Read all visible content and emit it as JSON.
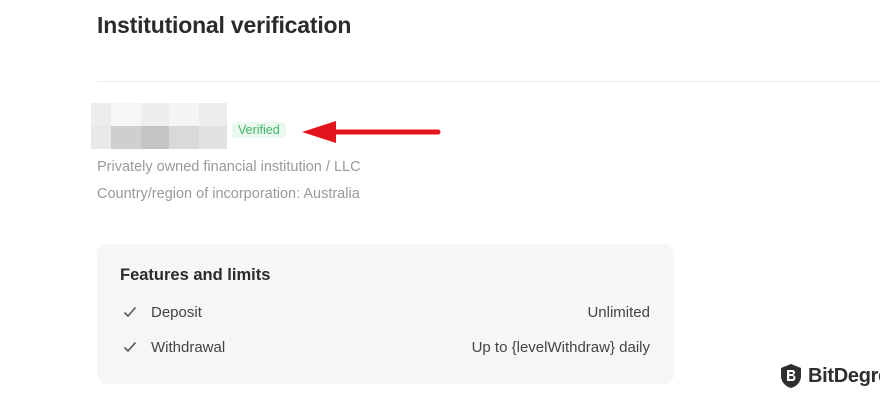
{
  "page": {
    "title": "Institutional verification"
  },
  "entity": {
    "status": "Verified",
    "type_line": "Privately owned financial institution / LLC",
    "country_line": "Country/region of incorporation: Australia",
    "name_redacted": true
  },
  "features": {
    "title": "Features and limits",
    "rows": [
      {
        "label": "Deposit",
        "value": "Unlimited",
        "icon": "check-icon"
      },
      {
        "label": "Withdrawal",
        "value": "Up to {levelWithdraw} daily",
        "icon": "check-icon"
      }
    ]
  },
  "annotation": {
    "arrow_color": "#e3141b"
  },
  "watermark": {
    "brand": "BitDegree",
    "icon": "bitdegree-shield-icon"
  },
  "colors": {
    "verified_text": "#3fb968",
    "verified_bg": "#eaf8ee",
    "card_bg": "#f6f6f6"
  }
}
